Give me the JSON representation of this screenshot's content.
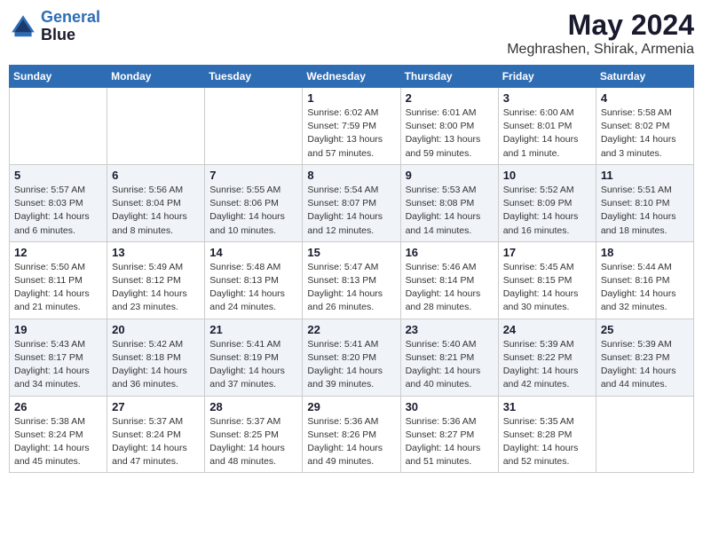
{
  "header": {
    "logo_line1": "General",
    "logo_line2": "Blue",
    "month_year": "May 2024",
    "location": "Meghrashen, Shirak, Armenia"
  },
  "weekdays": [
    "Sunday",
    "Monday",
    "Tuesday",
    "Wednesday",
    "Thursday",
    "Friday",
    "Saturday"
  ],
  "weeks": [
    [
      {
        "day": "",
        "info": ""
      },
      {
        "day": "",
        "info": ""
      },
      {
        "day": "",
        "info": ""
      },
      {
        "day": "1",
        "info": "Sunrise: 6:02 AM\nSunset: 7:59 PM\nDaylight: 13 hours\nand 57 minutes."
      },
      {
        "day": "2",
        "info": "Sunrise: 6:01 AM\nSunset: 8:00 PM\nDaylight: 13 hours\nand 59 minutes."
      },
      {
        "day": "3",
        "info": "Sunrise: 6:00 AM\nSunset: 8:01 PM\nDaylight: 14 hours\nand 1 minute."
      },
      {
        "day": "4",
        "info": "Sunrise: 5:58 AM\nSunset: 8:02 PM\nDaylight: 14 hours\nand 3 minutes."
      }
    ],
    [
      {
        "day": "5",
        "info": "Sunrise: 5:57 AM\nSunset: 8:03 PM\nDaylight: 14 hours\nand 6 minutes."
      },
      {
        "day": "6",
        "info": "Sunrise: 5:56 AM\nSunset: 8:04 PM\nDaylight: 14 hours\nand 8 minutes."
      },
      {
        "day": "7",
        "info": "Sunrise: 5:55 AM\nSunset: 8:06 PM\nDaylight: 14 hours\nand 10 minutes."
      },
      {
        "day": "8",
        "info": "Sunrise: 5:54 AM\nSunset: 8:07 PM\nDaylight: 14 hours\nand 12 minutes."
      },
      {
        "day": "9",
        "info": "Sunrise: 5:53 AM\nSunset: 8:08 PM\nDaylight: 14 hours\nand 14 minutes."
      },
      {
        "day": "10",
        "info": "Sunrise: 5:52 AM\nSunset: 8:09 PM\nDaylight: 14 hours\nand 16 minutes."
      },
      {
        "day": "11",
        "info": "Sunrise: 5:51 AM\nSunset: 8:10 PM\nDaylight: 14 hours\nand 18 minutes."
      }
    ],
    [
      {
        "day": "12",
        "info": "Sunrise: 5:50 AM\nSunset: 8:11 PM\nDaylight: 14 hours\nand 21 minutes."
      },
      {
        "day": "13",
        "info": "Sunrise: 5:49 AM\nSunset: 8:12 PM\nDaylight: 14 hours\nand 23 minutes."
      },
      {
        "day": "14",
        "info": "Sunrise: 5:48 AM\nSunset: 8:13 PM\nDaylight: 14 hours\nand 24 minutes."
      },
      {
        "day": "15",
        "info": "Sunrise: 5:47 AM\nSunset: 8:13 PM\nDaylight: 14 hours\nand 26 minutes."
      },
      {
        "day": "16",
        "info": "Sunrise: 5:46 AM\nSunset: 8:14 PM\nDaylight: 14 hours\nand 28 minutes."
      },
      {
        "day": "17",
        "info": "Sunrise: 5:45 AM\nSunset: 8:15 PM\nDaylight: 14 hours\nand 30 minutes."
      },
      {
        "day": "18",
        "info": "Sunrise: 5:44 AM\nSunset: 8:16 PM\nDaylight: 14 hours\nand 32 minutes."
      }
    ],
    [
      {
        "day": "19",
        "info": "Sunrise: 5:43 AM\nSunset: 8:17 PM\nDaylight: 14 hours\nand 34 minutes."
      },
      {
        "day": "20",
        "info": "Sunrise: 5:42 AM\nSunset: 8:18 PM\nDaylight: 14 hours\nand 36 minutes."
      },
      {
        "day": "21",
        "info": "Sunrise: 5:41 AM\nSunset: 8:19 PM\nDaylight: 14 hours\nand 37 minutes."
      },
      {
        "day": "22",
        "info": "Sunrise: 5:41 AM\nSunset: 8:20 PM\nDaylight: 14 hours\nand 39 minutes."
      },
      {
        "day": "23",
        "info": "Sunrise: 5:40 AM\nSunset: 8:21 PM\nDaylight: 14 hours\nand 40 minutes."
      },
      {
        "day": "24",
        "info": "Sunrise: 5:39 AM\nSunset: 8:22 PM\nDaylight: 14 hours\nand 42 minutes."
      },
      {
        "day": "25",
        "info": "Sunrise: 5:39 AM\nSunset: 8:23 PM\nDaylight: 14 hours\nand 44 minutes."
      }
    ],
    [
      {
        "day": "26",
        "info": "Sunrise: 5:38 AM\nSunset: 8:24 PM\nDaylight: 14 hours\nand 45 minutes."
      },
      {
        "day": "27",
        "info": "Sunrise: 5:37 AM\nSunset: 8:24 PM\nDaylight: 14 hours\nand 47 minutes."
      },
      {
        "day": "28",
        "info": "Sunrise: 5:37 AM\nSunset: 8:25 PM\nDaylight: 14 hours\nand 48 minutes."
      },
      {
        "day": "29",
        "info": "Sunrise: 5:36 AM\nSunset: 8:26 PM\nDaylight: 14 hours\nand 49 minutes."
      },
      {
        "day": "30",
        "info": "Sunrise: 5:36 AM\nSunset: 8:27 PM\nDaylight: 14 hours\nand 51 minutes."
      },
      {
        "day": "31",
        "info": "Sunrise: 5:35 AM\nSunset: 8:28 PM\nDaylight: 14 hours\nand 52 minutes."
      },
      {
        "day": "",
        "info": ""
      }
    ]
  ]
}
